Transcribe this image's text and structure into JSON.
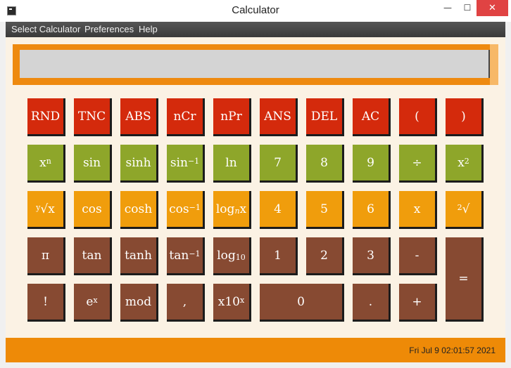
{
  "window": {
    "title": "Calculator",
    "minimize_glyph": "—",
    "maximize_glyph": "☐",
    "close_glyph": "✕"
  },
  "menu": {
    "items": [
      "Select Calculator",
      "Preferences",
      "Help"
    ]
  },
  "display": {
    "value": ""
  },
  "keypad": {
    "row1": [
      "RND",
      "TNC",
      "ABS",
      "nCr",
      "nPr",
      "ANS",
      "DEL",
      "AC",
      "(",
      ")"
    ],
    "row2": {
      "power_base": "x",
      "power_exp": "n",
      "sin": "sin",
      "sinh": "sinh",
      "asin_base": "sin",
      "asin_exp": "−1",
      "ln": "ln",
      "d7": "7",
      "d8": "8",
      "d9": "9",
      "div": "÷",
      "square_base": "x",
      "square_exp": "2"
    },
    "row3": {
      "yroot_index": "y",
      "yroot_symbol": "√x",
      "cos": "cos",
      "cosh": "cosh",
      "acos_base": "cos",
      "acos_exp": "−1",
      "logn_prefix": "log",
      "logn_sub": "n",
      "logn_suffix": "x",
      "d4": "4",
      "d5": "5",
      "d6": "6",
      "mul": "x",
      "sqrt_index": "2",
      "sqrt_symbol": "√"
    },
    "row4": {
      "pi": "π",
      "tan": "tan",
      "tanh": "tanh",
      "atan_base": "tan",
      "atan_exp": "−1",
      "log10_prefix": "log",
      "log10_sub": "10",
      "d1": "1",
      "d2": "2",
      "d3": "3",
      "sub": "-",
      "equals": "="
    },
    "row5": {
      "fact": "!",
      "exp_base": "e",
      "exp_exp": "x",
      "mod": "mod",
      "comma": ",",
      "sci_base": "x10",
      "sci_exp": "x",
      "d0": "0",
      "dot": ".",
      "add": "+"
    }
  },
  "status": {
    "datetime": "Fri Jul 9 02:01:57 2021"
  },
  "colors": {
    "red": "#d42a0c",
    "green": "#8ea62a",
    "orange": "#f09d0c",
    "brown": "#874a32",
    "accent": "#ee8a07",
    "background": "#fbf2e4",
    "display": "#d4d4d4"
  },
  "icons": {
    "app": "calculator-app-icon"
  }
}
